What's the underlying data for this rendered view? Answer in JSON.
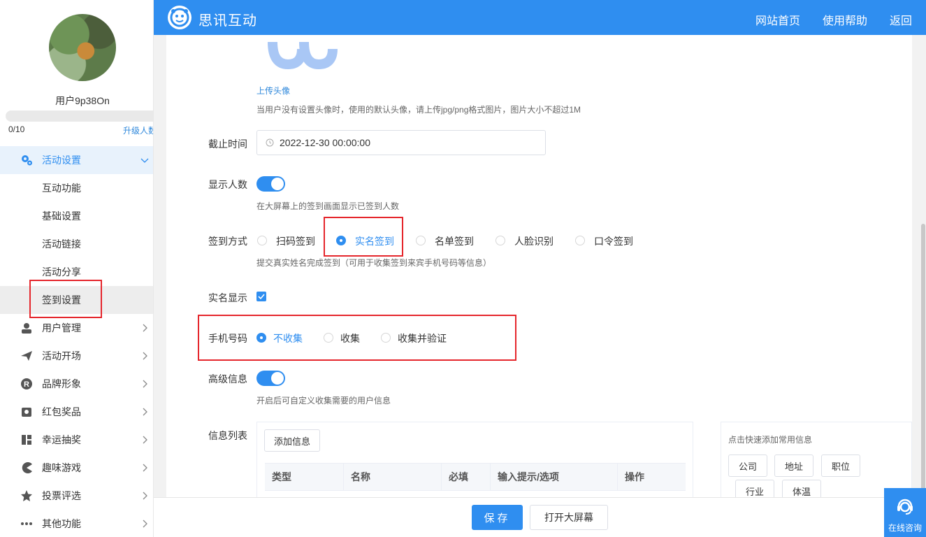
{
  "sidebar": {
    "username": "用户9p38On",
    "quota": "0/10",
    "upgrade": "升级人数",
    "menu": {
      "active": "活动设置",
      "sub_items": [
        "互动功能",
        "基础设置",
        "活动链接",
        "活动分享",
        "签到设置"
      ],
      "items": [
        "用户管理",
        "活动开场",
        "品牌形象",
        "红包奖品",
        "幸运抽奖",
        "趣味游戏",
        "投票评选",
        "其他功能"
      ]
    }
  },
  "topbar": {
    "brand": "思讯互动",
    "links": [
      "网站首页",
      "使用帮助",
      "返回"
    ]
  },
  "form": {
    "upload_avatar": "上传头像",
    "avatar_hint": "当用户没有设置头像时，使用的默认头像，请上传jpg/png格式图片，图片大小不超过1M",
    "deadline_label": "截止时间",
    "deadline_value": "2022-12-30 00:00:00",
    "show_count_label": "显示人数",
    "show_count_hint": "在大屏幕上的签到画面显示已签到人数",
    "signin_method_label": "签到方式",
    "signin_methods": [
      "扫码签到",
      "实名签到",
      "名单签到",
      "人脸识别",
      "口令签到"
    ],
    "signin_method_selected": "实名签到",
    "signin_hint": "提交真实姓名完成签到（可用于收集签到来宾手机号码等信息）",
    "realname_display_label": "实名显示",
    "phone_label": "手机号码",
    "phone_options": [
      "不收集",
      "收集",
      "收集并验证"
    ],
    "phone_selected": "不收集",
    "advanced_label": "高级信息",
    "advanced_hint": "开启后可自定义收集需要的用户信息",
    "info_list_label": "信息列表",
    "add_info_button": "添加信息",
    "table_headers": [
      "类型",
      "名称",
      "必填",
      "输入提示/选项",
      "操作"
    ],
    "quick_add_title": "点击快速添加常用信息",
    "quick_add_items": [
      "公司",
      "地址",
      "职位",
      "行业",
      "体温"
    ]
  },
  "footer": {
    "save": "保存",
    "open_screen": "打开大屏幕"
  },
  "consult": "在线咨询",
  "colors": {
    "primary": "#2f8ef0",
    "highlight_box": "#e5262c"
  }
}
